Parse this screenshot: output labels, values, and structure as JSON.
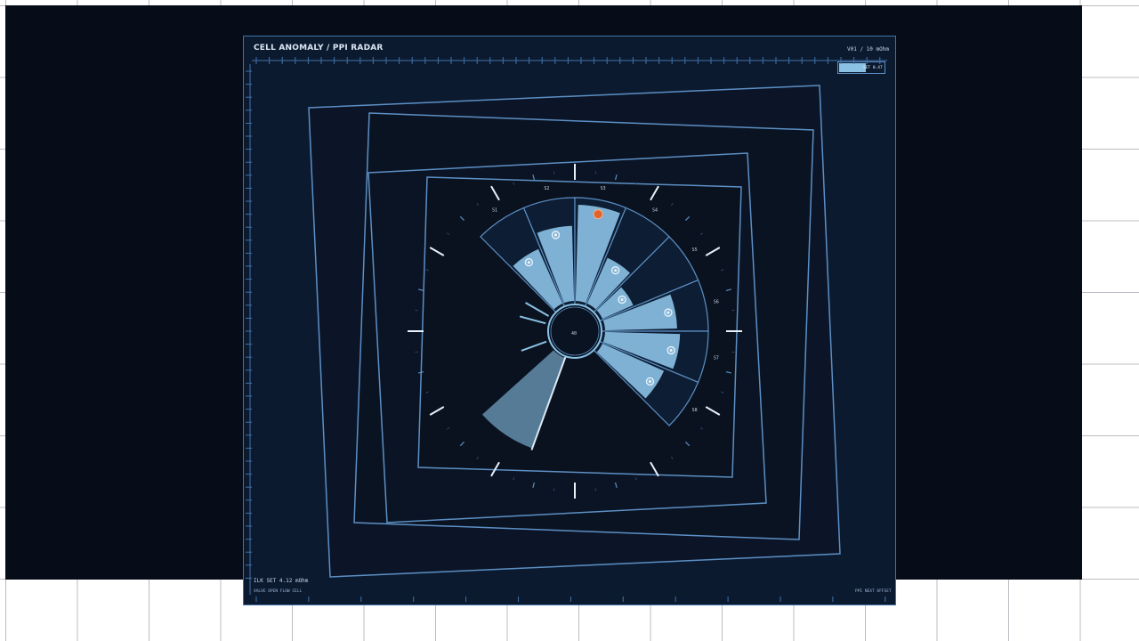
{
  "panel": {
    "title": "CELL ANOMALY  /  PPI RADAR",
    "range_label": "V01 / 10  mOhm",
    "legend_label": "SET 0.47",
    "status_value": "ILK SET  4.12 mOhm",
    "status_tags": "VALVE OPEN  FLOW CELL",
    "footer_right": "PPI NEXT OFFSET"
  },
  "radar": {
    "center_label": "40",
    "sector_labels": [
      "S1",
      "S2",
      "S3",
      "S4",
      "S5",
      "S6",
      "S7",
      "S8"
    ],
    "colors": {
      "accent": "#8bc2e4",
      "frame": "#5c8fc4",
      "highlight": "#e2622c",
      "sweep": "#6f9fbd"
    },
    "sectors": [
      {
        "label": "S1",
        "value": 0.62
      },
      {
        "label": "S2",
        "value": 0.78
      },
      {
        "label": "S3",
        "value": 1.0,
        "highlight": true
      },
      {
        "label": "S4",
        "value": 0.52
      },
      {
        "label": "S5",
        "value": 0.35
      },
      {
        "label": "S6",
        "value": 0.75
      },
      {
        "label": "S7",
        "value": 0.78
      },
      {
        "label": "S8",
        "value": 0.7
      }
    ]
  }
}
